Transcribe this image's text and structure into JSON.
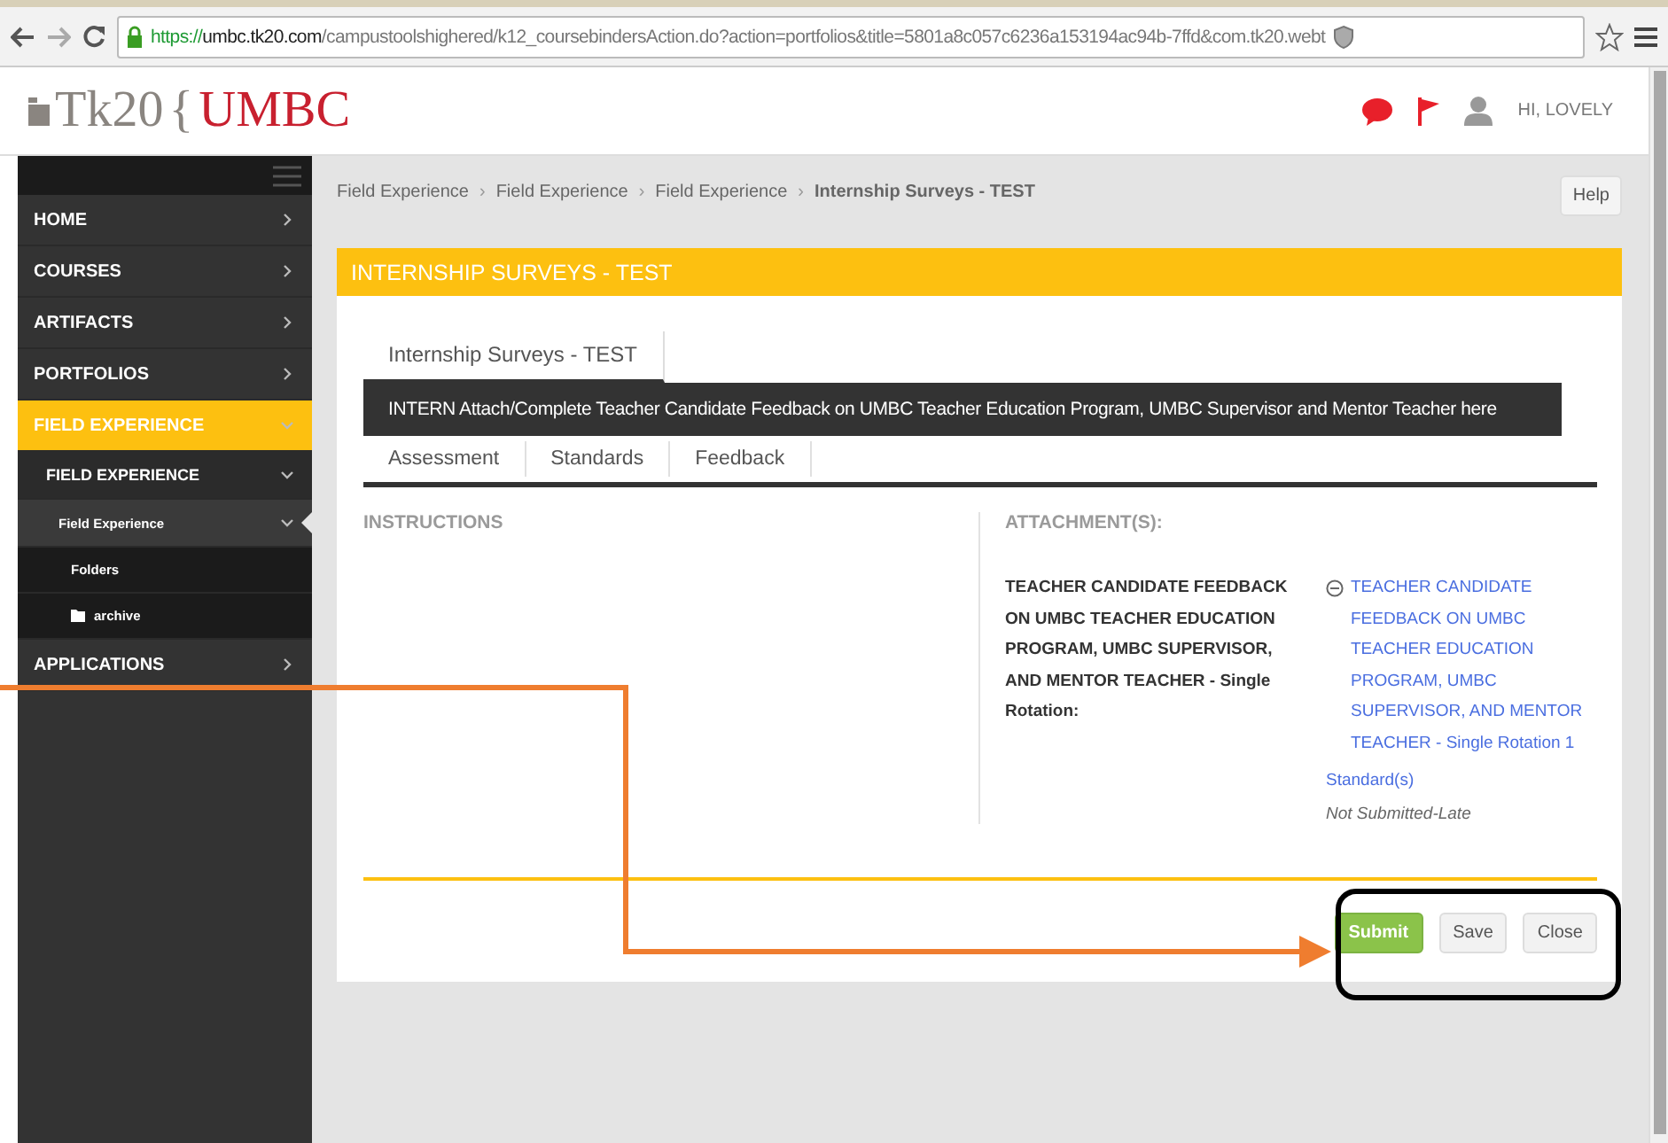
{
  "browser": {
    "address": {
      "scheme": "https://",
      "host": "umbc.tk20.com",
      "path": "/campustoolshighered/k12_coursebindersAction.do?action=portfolios&title=5801a8c057c6236a153194ac94b-7ffd&com.tk20.webt"
    }
  },
  "header": {
    "logo": {
      "left": "Tk20",
      "brace": "{",
      "right": "UMBC"
    },
    "greeting": "HI, LOVELY"
  },
  "sidebar": {
    "items": [
      {
        "label": "HOME",
        "selected": false,
        "expanded": false
      },
      {
        "label": "COURSES",
        "selected": false,
        "expanded": false
      },
      {
        "label": "ARTIFACTS",
        "selected": false,
        "expanded": false
      },
      {
        "label": "PORTFOLIOS",
        "selected": false,
        "expanded": false
      },
      {
        "label": "FIELD EXPERIENCE",
        "selected": true,
        "expanded": true,
        "children": [
          {
            "label": "FIELD EXPERIENCE",
            "selected": false,
            "expanded": true,
            "children": [
              {
                "label": "Field Experience",
                "selected": true,
                "expanded": true,
                "children": [
                  {
                    "label": "Folders",
                    "kind": "plain",
                    "selected": false
                  },
                  {
                    "label": "archive",
                    "kind": "folder",
                    "selected": false
                  }
                ]
              }
            ]
          }
        ]
      },
      {
        "label": "APPLICATIONS",
        "selected": false,
        "expanded": false
      }
    ]
  },
  "breadcrumb": [
    {
      "label": "Field Experience",
      "current": false
    },
    {
      "label": "Field Experience",
      "current": false
    },
    {
      "label": "Field Experience",
      "current": false
    },
    {
      "label": "Internship Surveys - TEST",
      "current": true
    }
  ],
  "breadcrumb_separator": "›",
  "help_button": "Help",
  "panel": {
    "title": "INTERNSHIP SURVEYS - TEST",
    "tabs": [
      {
        "label": "Internship Surveys - TEST",
        "selected": true
      }
    ],
    "banner": "INTERN Attach/Complete Teacher Candidate Feedback on UMBC Teacher Education Program, UMBC Supervisor and Mentor Teacher here",
    "subtabs": [
      {
        "label": "Assessment",
        "selected": false
      },
      {
        "label": "Standards",
        "selected": false
      },
      {
        "label": "Feedback",
        "selected": false
      }
    ],
    "instructions_heading": "INSTRUCTIONS",
    "attachments_heading": "ATTACHMENT(S):",
    "attachment": {
      "label": "TEACHER CANDIDATE FEEDBACK ON UMBC TEACHER EDUCATION PROGRAM, UMBC SUPERVISOR, AND MENTOR TEACHER - Single Rotation:",
      "link": "TEACHER CANDIDATE FEEDBACK ON UMBC TEACHER EDUCATION PROGRAM, UMBC SUPERVISOR, AND MENTOR TEACHER - Single Rotation 1",
      "standards_link": "Standard(s)",
      "status": "Not Submitted-Late"
    },
    "buttons": [
      {
        "label": "Submit",
        "kind": "primary"
      },
      {
        "label": "Save",
        "kind": "default"
      },
      {
        "label": "Close",
        "kind": "default"
      }
    ]
  }
}
